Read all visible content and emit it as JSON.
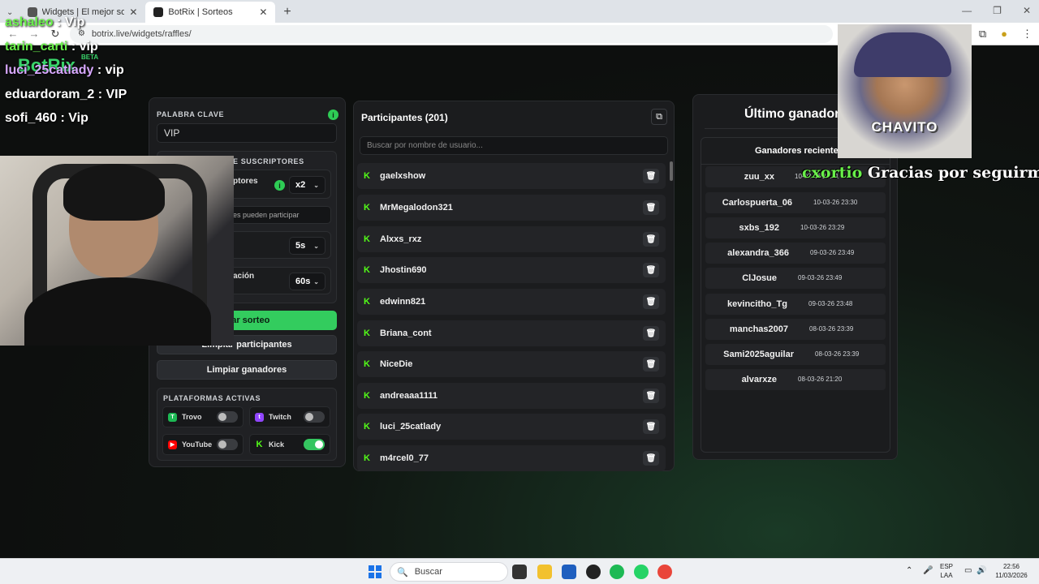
{
  "browser": {
    "tabs": [
      {
        "title": "Widgets | El mejor software pa",
        "active": false
      },
      {
        "title": "BotRix | Sorteos",
        "active": true
      }
    ],
    "url": "botrix.live/widgets/raffles/",
    "new_tab": "+"
  },
  "site": {
    "logo": "BotRix",
    "badge": "BETA"
  },
  "settings": {
    "keyword_label": "PALABRA CLAVE",
    "keyword_value": "VIP",
    "subs_title": "E SUSCRIPTORES",
    "subs_row_label": "ptores",
    "subs_multiplier": "x2",
    "subs_only_placeholder": "es pueden participar",
    "time_value": "5s",
    "duration_label": "ación",
    "duration_value": "60s",
    "start_button": "iciar sorteo",
    "clear_participants": "Limpiar participantes",
    "clear_winners": "Limpiar ganadores",
    "platforms_title": "PLATAFORMAS ACTIVAS",
    "platforms": [
      {
        "name": "Trovo",
        "enabled": false,
        "color": "#1db954"
      },
      {
        "name": "Twitch",
        "enabled": false,
        "color": "#9146ff"
      },
      {
        "name": "YouTube",
        "enabled": false,
        "color": "#ff0000"
      },
      {
        "name": "Kick",
        "enabled": true,
        "color": "#53fc18"
      }
    ]
  },
  "participants": {
    "title": "Participantes (201)",
    "search_placeholder": "Buscar por nombre de usuario...",
    "items": [
      "gaelxshow",
      "MrMegalodon321",
      "Alxxs_rxz",
      "Jhostin690",
      "edwinn821",
      "Briana_cont",
      "NiceDie",
      "andreaaa1111",
      "luci_25catlady",
      "m4rcel0_77"
    ]
  },
  "winners": {
    "last_winner_label": "Último ganador:",
    "recent_title": "Ganadores recientes",
    "items": [
      {
        "name": "zuu_xx",
        "date": "10-03-26 23:31"
      },
      {
        "name": "Carlospuerta_06",
        "date": "10-03-26 23:30"
      },
      {
        "name": "sxbs_192",
        "date": "10-03-26 23:29"
      },
      {
        "name": "alexandra_366",
        "date": "09-03-26 23:49"
      },
      {
        "name": "ClJosue",
        "date": "09-03-26 23:49"
      },
      {
        "name": "kevincitho_Tg",
        "date": "09-03-26 23:48"
      },
      {
        "name": "manchas2007",
        "date": "08-03-26 23:39"
      },
      {
        "name": "Sami2025aguilar",
        "date": "08-03-26 23:39"
      },
      {
        "name": "alvarxze",
        "date": "08-03-26 21:20"
      }
    ]
  },
  "overlay": {
    "chat": [
      {
        "user": "ashaleo",
        "msg": " : Vip"
      },
      {
        "user": "tarin_carti",
        "msg": " : vip"
      },
      {
        "user": "luci_25catlady",
        "msg": " : vip"
      },
      {
        "user": "eduardoram_2",
        "msg": " : VIP"
      },
      {
        "user": "sofi_460",
        "msg": " : Vip"
      }
    ],
    "photo_caption": "CHAVITO",
    "follow_user": "cxortio",
    "follow_msg": " Gracias por seguirme!!"
  },
  "taskbar": {
    "search": "Buscar",
    "lang_top": "ESP",
    "lang_bottom": "LAA",
    "time": "22:56",
    "date": "11/03/2026"
  }
}
